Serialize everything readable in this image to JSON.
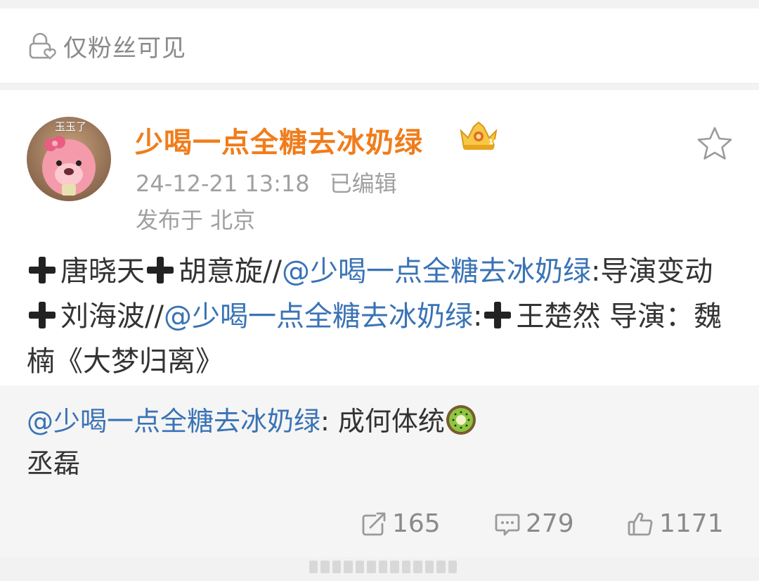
{
  "visibility": {
    "label": "仅粉丝可见",
    "icon": "lock-heart-icon"
  },
  "post": {
    "author": {
      "name": "少喝一点全糖去冰奶绿",
      "avatar_tag": "玉玉了",
      "badge_icon": "crown-badge-icon"
    },
    "timestamp": "24-12-21 13:18",
    "edited_label": "已编辑",
    "location": "发布于 北京",
    "content": {
      "seg1": "唐晓天",
      "seg2": "胡意旋//",
      "mention1": "@少喝一点全糖去冰奶绿",
      "seg3": ":导演变动",
      "seg4": "刘海波//",
      "mention2": "@少喝一点全糖去冰奶绿",
      "seg5": ":",
      "seg6": "王楚然 导演：魏楠《大梦归离》"
    }
  },
  "quote": {
    "mention": "@少喝一点全糖去冰奶绿",
    "text": ": 成何体统",
    "line2": "丞磊",
    "emoji_icon": "kiwi-icon"
  },
  "actions": {
    "reposts": "165",
    "comments": "279",
    "likes": "1171"
  },
  "colors": {
    "username": "#f07d1c",
    "mention": "#3a73b5",
    "meta": "#a0a0a0",
    "icon_gray": "#8a8a8a"
  }
}
